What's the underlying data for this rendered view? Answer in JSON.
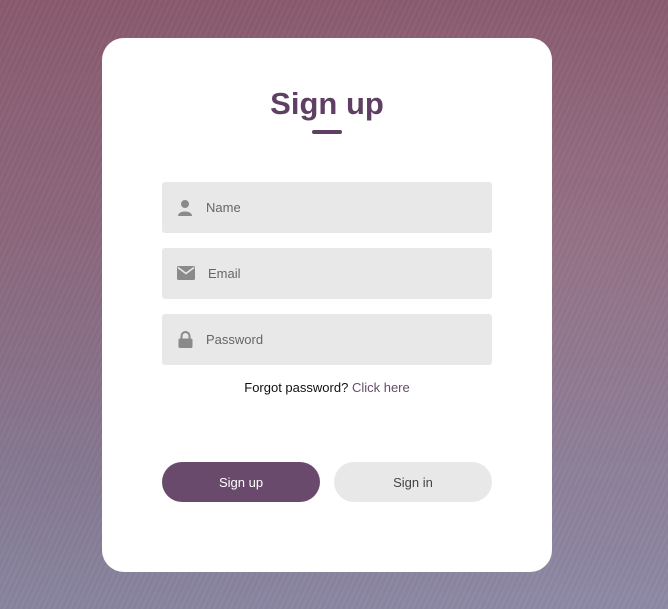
{
  "form": {
    "title": "Sign up",
    "fields": {
      "name": {
        "placeholder": "Name",
        "icon": "user-icon"
      },
      "email": {
        "placeholder": "Email",
        "icon": "envelope-icon"
      },
      "password": {
        "placeholder": "Password",
        "icon": "lock-icon"
      }
    },
    "forgot": {
      "text": "Forgot password?",
      "link": "Click here"
    },
    "buttons": {
      "signup": "Sign up",
      "signin": "Sign in"
    }
  },
  "colors": {
    "accent": "#6a4a6c",
    "field_bg": "#e8e8e8",
    "card_bg": "#ffffff"
  }
}
